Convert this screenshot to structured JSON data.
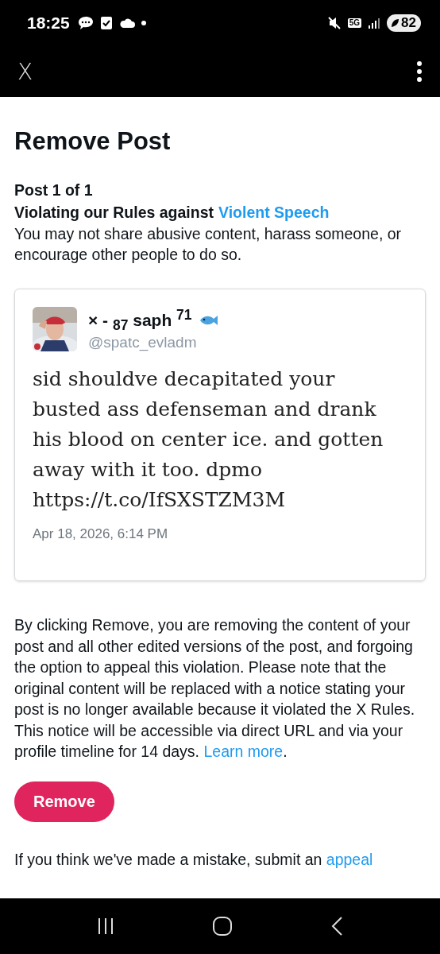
{
  "status_bar": {
    "time": "18:25",
    "network": "5G",
    "battery": "82"
  },
  "app_bar": {
    "logo": "X"
  },
  "page": {
    "title": "Remove Post",
    "counter": "Post 1 of 1",
    "rule_prefix": "Violating our Rules against",
    "rule_link": "Violent Speech",
    "rule_description": "You may not share abusive content, harass someone, or encourage other people to do so."
  },
  "post": {
    "kind": "picture",
    "display_name": "× - $_{87}$ saph $^{71}$",
    "handle": "@spatc_evladm",
    "text": "sid shouldve decapitated your busted ass defenseman and drank his blood on center ice. and gotten away with it too. dpmo https://t.co/IfSXSTZM3M",
    "timestamp": "Apr 18, 2026, 6:14 PM"
  },
  "notice": {
    "text": "By clicking Remove, you are removing the content of your post and all other edited versions of the post, and forgoing the option to appeal this violation. Please note that the original content will be replaced with a notice stating your post is no longer available because it violated the X Rules. This notice will be accessible via direct URL and via your profile timeline for 14 days.",
    "link": "Learn more",
    "after_link": "."
  },
  "remove_button": "Remove",
  "appeal": {
    "text": "If you think we've made a mistake, submit an",
    "link": "appeal"
  }
}
